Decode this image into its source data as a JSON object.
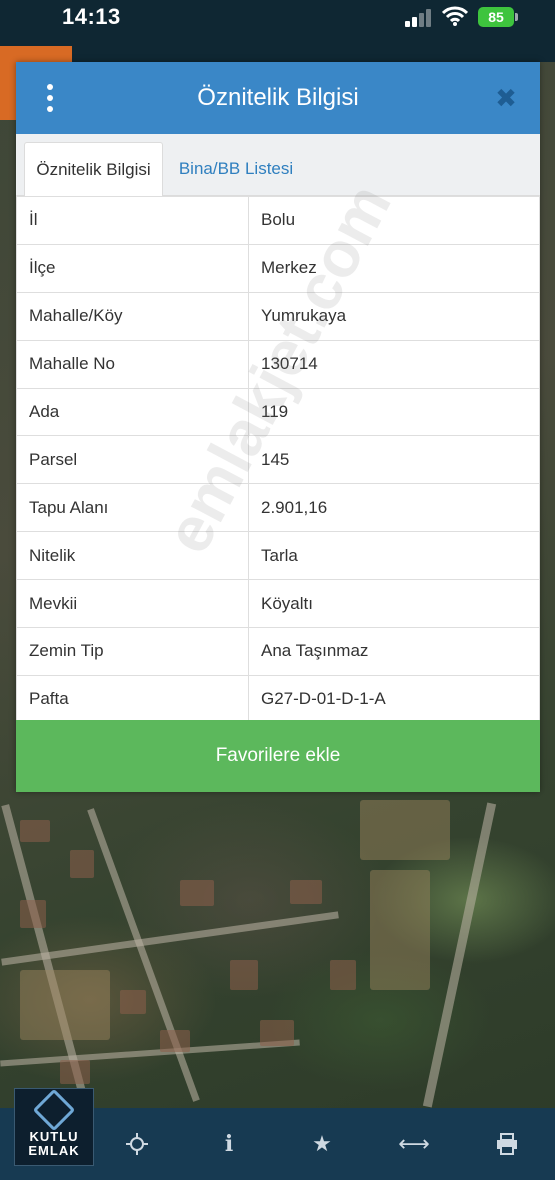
{
  "status_bar": {
    "time": "14:13",
    "battery": "85"
  },
  "dialog": {
    "title": "Öznitelik Bilgisi",
    "tabs": [
      {
        "label": "Öznitelik Bilgisi",
        "active": true
      },
      {
        "label": "Bina/BB Listesi",
        "active": false
      }
    ],
    "rows": [
      {
        "key": "İl",
        "value": "Bolu"
      },
      {
        "key": "İlçe",
        "value": "Merkez"
      },
      {
        "key": "Mahalle/Köy",
        "value": "Yumrukaya"
      },
      {
        "key": "Mahalle No",
        "value": "130714"
      },
      {
        "key": "Ada",
        "value": "119"
      },
      {
        "key": "Parsel",
        "value": "145"
      },
      {
        "key": "Tapu Alanı",
        "value": "2.901,16"
      },
      {
        "key": "Nitelik",
        "value": "Tarla"
      },
      {
        "key": "Mevkii",
        "value": "Köyaltı"
      },
      {
        "key": "Zemin Tip",
        "value": "Ana Taşınmaz"
      },
      {
        "key": "Pafta",
        "value": "G27-D-01-D-1-A"
      }
    ],
    "favorite_button": "Favorilere ekle"
  },
  "watermark": "emlakjet.com",
  "logo": {
    "line1": "KUTLU",
    "line2": "EMLAK"
  },
  "toolbar": {
    "icons": [
      "crosshair-icon",
      "info-icon",
      "star-icon",
      "measure-icon",
      "print-icon"
    ]
  },
  "colors": {
    "header": "#3a87c7",
    "favorite_button": "#5cb85c",
    "toolbar": "#173a52",
    "tab_link": "#2f7fbf"
  }
}
